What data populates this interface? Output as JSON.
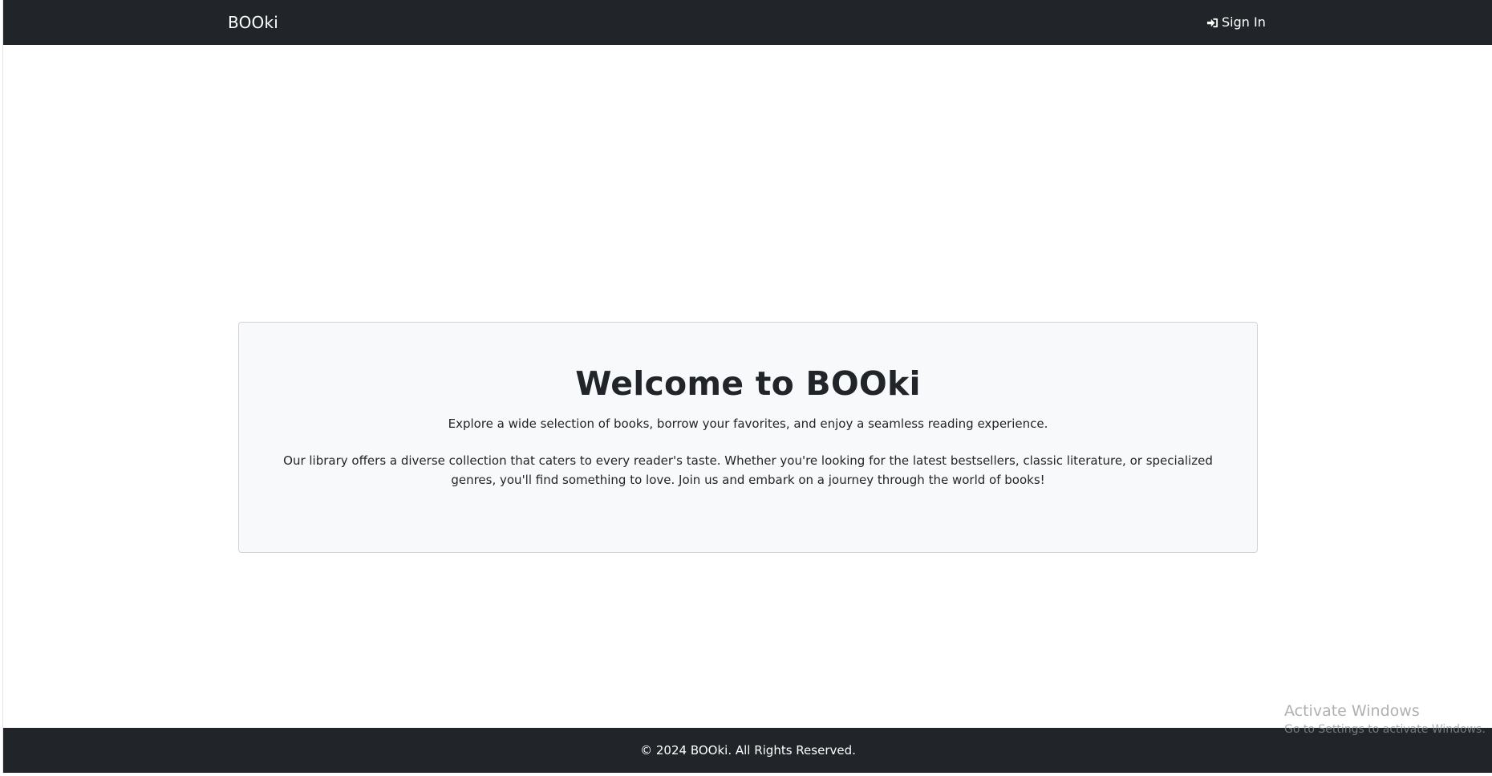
{
  "navbar": {
    "brand": "BOOki",
    "signin_label": "Sign In",
    "signin_icon": "sign-in-icon"
  },
  "hero": {
    "title": "Welcome to BOOki",
    "lead": "Explore a wide selection of books, borrow your favorites, and enjoy a seamless reading experience.",
    "description": "Our library offers a diverse collection that caters to every reader's taste. Whether you're looking for the latest bestsellers, classic literature, or specialized genres, you'll find something to love. Join us and embark on a journey through the world of books!"
  },
  "footer": {
    "text": "© 2024 BOOki. All Rights Reserved."
  },
  "watermark": {
    "line1": "Activate Windows",
    "line2": "Go to Settings to activate Windows."
  },
  "colors": {
    "navbar_bg": "#212529",
    "hero_bg": "#f8f9fa",
    "text": "#212529"
  }
}
